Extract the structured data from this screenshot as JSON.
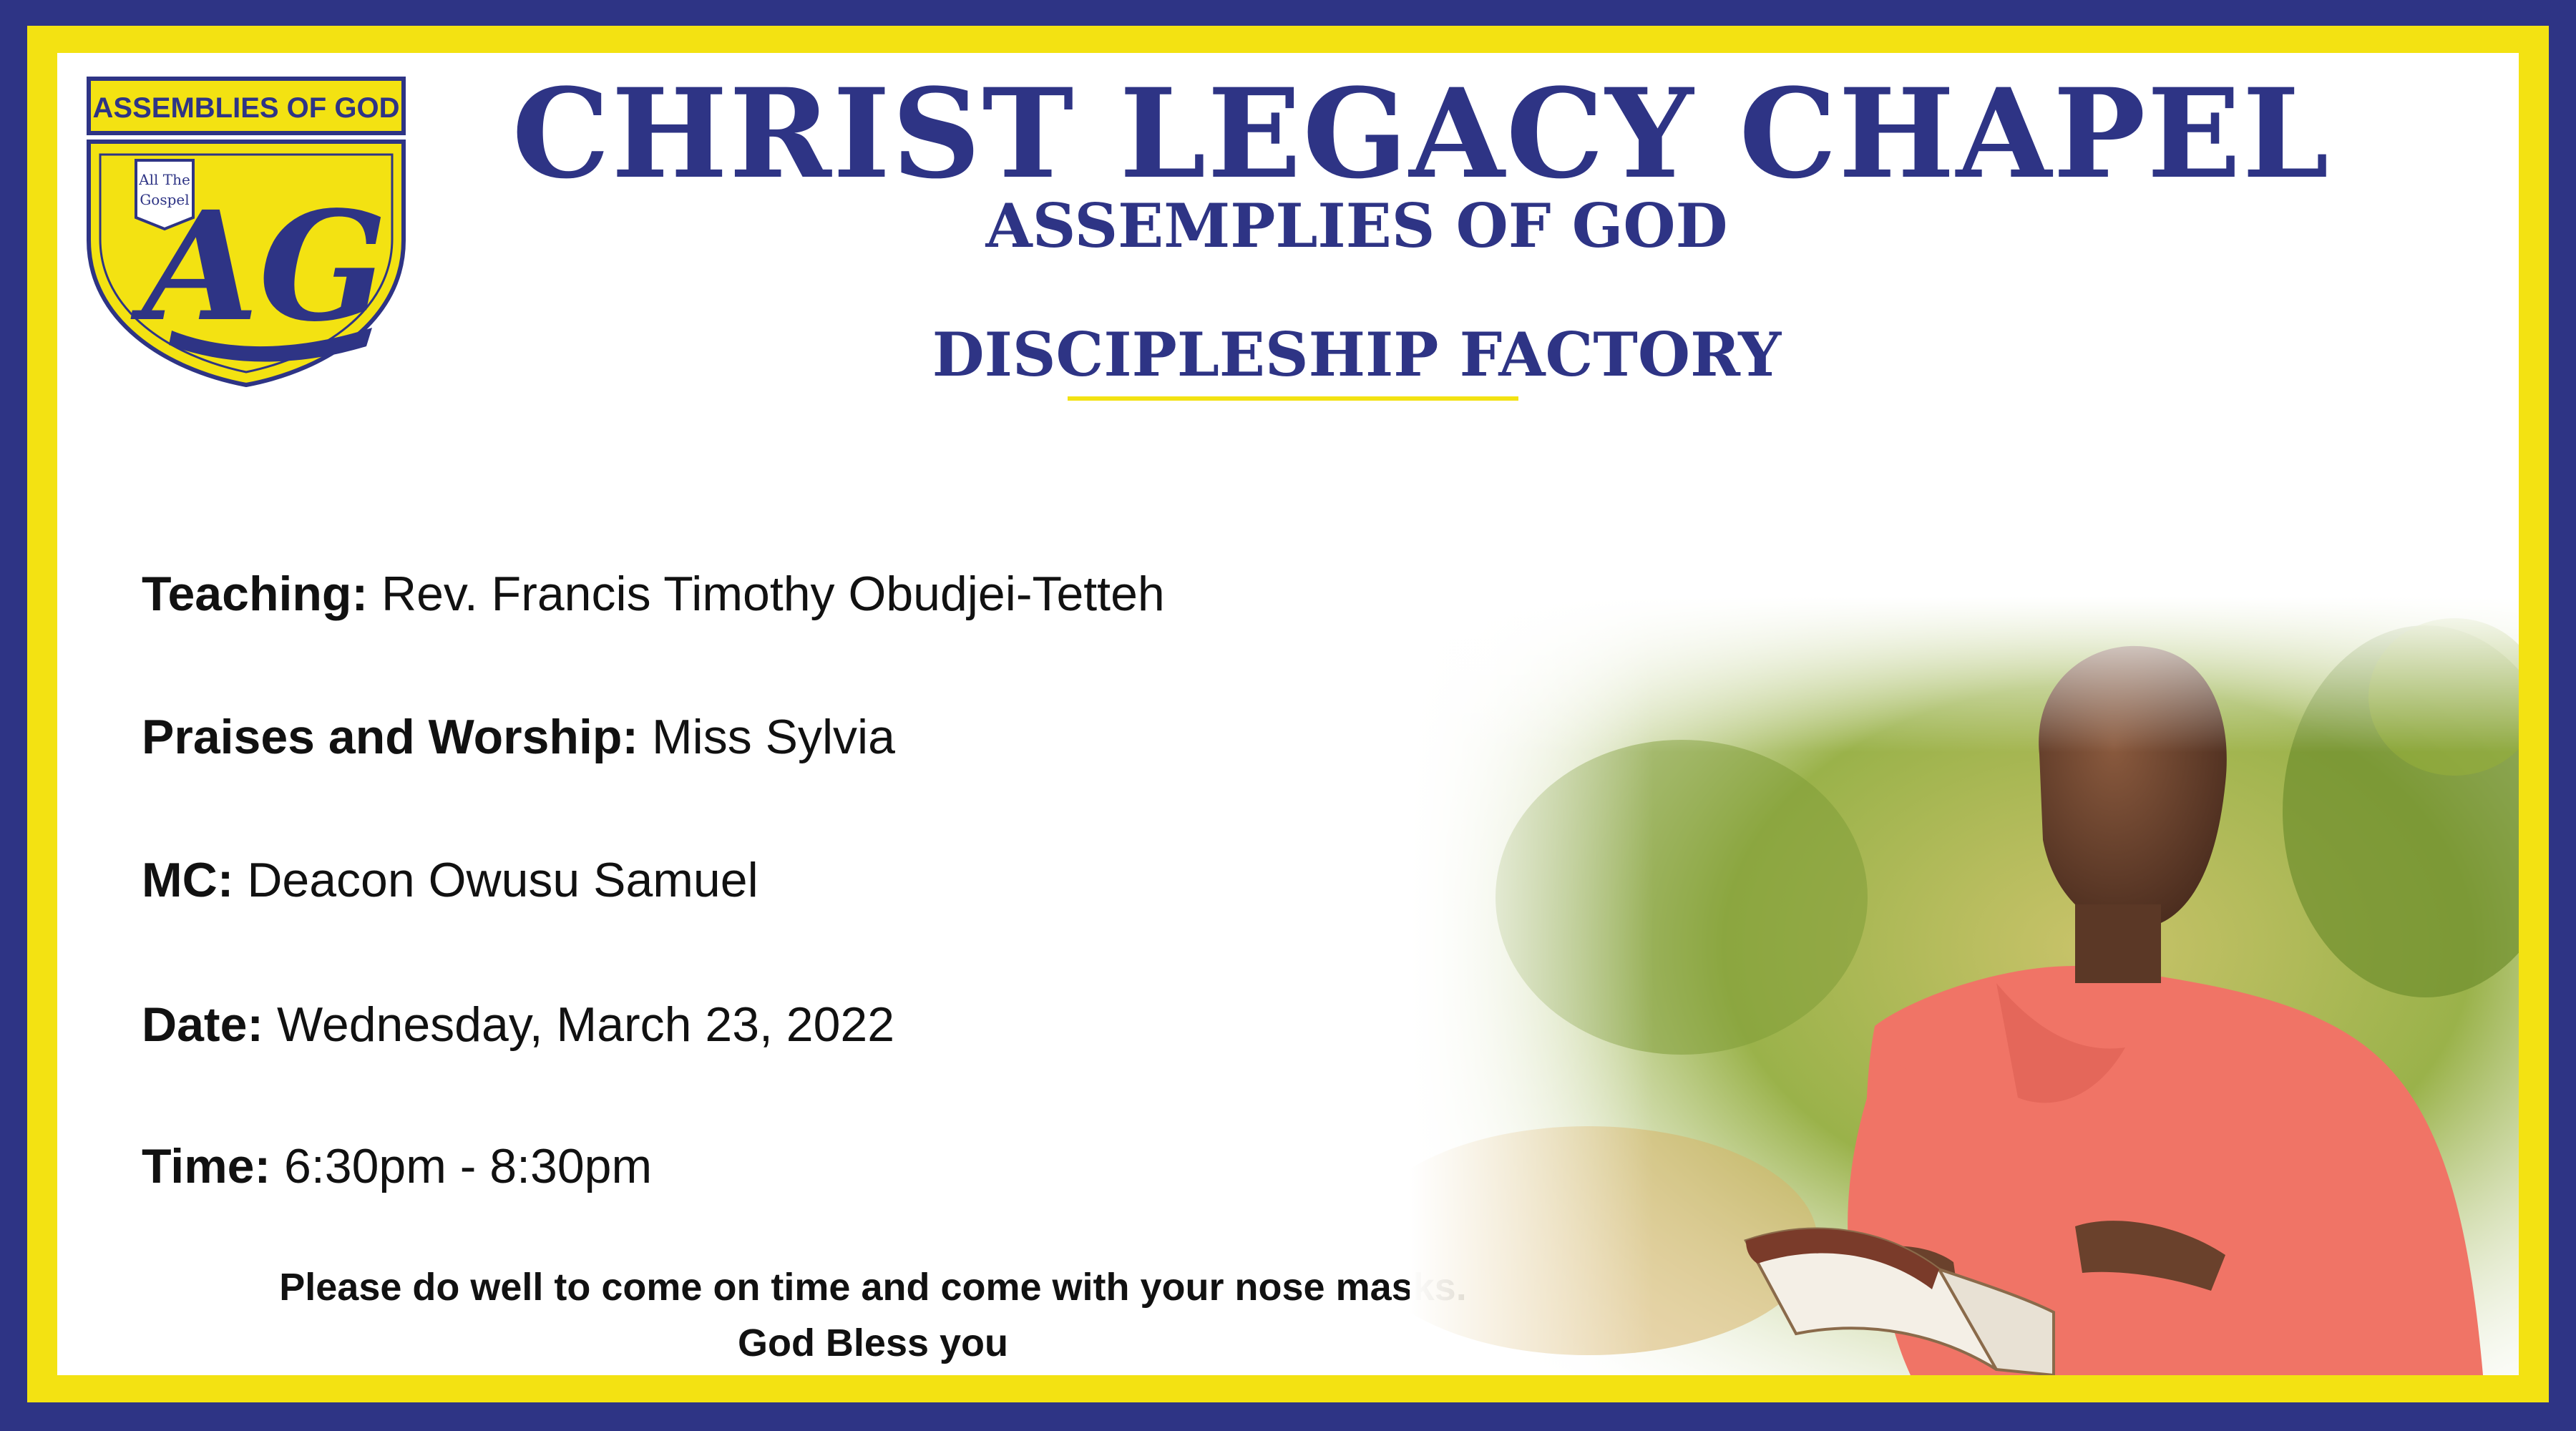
{
  "logo": {
    "banner_text": "ASSEMBLIES OF GOD",
    "book_text_line1": "All The",
    "book_text_line2": "Gospel",
    "monogram": "AG"
  },
  "header": {
    "church_name": "CHRIST LEGACY CHAPEL",
    "denomination": "ASSEMPLIES OF GOD",
    "program_title": "DISCIPLESHIP FACTORY"
  },
  "details": [
    {
      "label": "Teaching:",
      "value": "Rev. Francis Timothy Obudjei-Tetteh"
    },
    {
      "label": "Praises and Worship:",
      "value": "Miss Sylvia"
    },
    {
      "label": "MC:",
      "value": "Deacon Owusu Samuel"
    },
    {
      "label": "Date:",
      "value": "Wednesday, March 23, 2022"
    },
    {
      "label": "Time:",
      "value": "6:30pm - 8:30pm"
    }
  ],
  "footer": {
    "notice": "Please do well to come on time and come with your nose masks.",
    "blessing": "God Bless you"
  },
  "colors": {
    "navy": "#2e3485",
    "yellow": "#f3e212",
    "shirt": "#f07466"
  },
  "photo_subject": "man-reading-bible"
}
